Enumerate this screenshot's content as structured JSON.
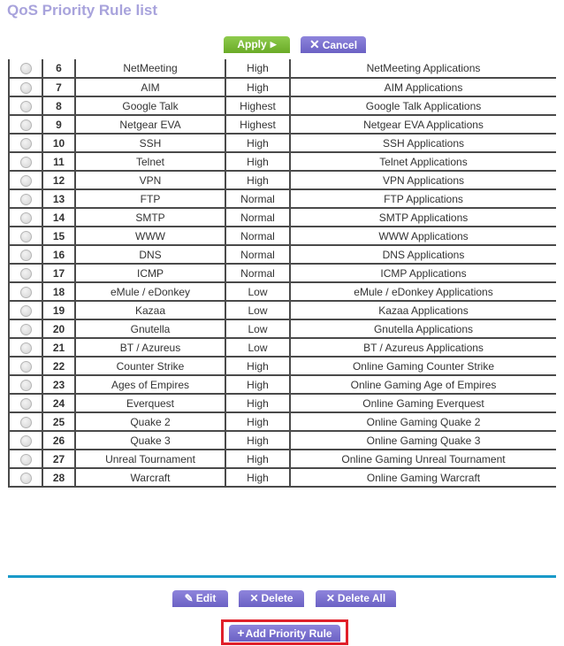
{
  "page": {
    "title": "QoS Priority Rule list"
  },
  "toolbar": {
    "apply_label": "Apply",
    "apply_icon": "play-triangle-icon",
    "cancel_label": "Cancel",
    "cancel_icon": "x-icon"
  },
  "rules": [
    {
      "num": "6",
      "name": "NetMeeting",
      "priority": "High",
      "description": "NetMeeting Applications"
    },
    {
      "num": "7",
      "name": "AIM",
      "priority": "High",
      "description": "AIM Applications"
    },
    {
      "num": "8",
      "name": "Google Talk",
      "priority": "Highest",
      "description": "Google Talk Applications"
    },
    {
      "num": "9",
      "name": "Netgear EVA",
      "priority": "Highest",
      "description": "Netgear EVA Applications"
    },
    {
      "num": "10",
      "name": "SSH",
      "priority": "High",
      "description": "SSH Applications"
    },
    {
      "num": "11",
      "name": "Telnet",
      "priority": "High",
      "description": "Telnet Applications"
    },
    {
      "num": "12",
      "name": "VPN",
      "priority": "High",
      "description": "VPN Applications"
    },
    {
      "num": "13",
      "name": "FTP",
      "priority": "Normal",
      "description": "FTP Applications"
    },
    {
      "num": "14",
      "name": "SMTP",
      "priority": "Normal",
      "description": "SMTP Applications"
    },
    {
      "num": "15",
      "name": "WWW",
      "priority": "Normal",
      "description": "WWW Applications"
    },
    {
      "num": "16",
      "name": "DNS",
      "priority": "Normal",
      "description": "DNS Applications"
    },
    {
      "num": "17",
      "name": "ICMP",
      "priority": "Normal",
      "description": "ICMP Applications"
    },
    {
      "num": "18",
      "name": "eMule / eDonkey",
      "priority": "Low",
      "description": "eMule / eDonkey Applications"
    },
    {
      "num": "19",
      "name": "Kazaa",
      "priority": "Low",
      "description": "Kazaa Applications"
    },
    {
      "num": "20",
      "name": "Gnutella",
      "priority": "Low",
      "description": "Gnutella Applications"
    },
    {
      "num": "21",
      "name": "BT / Azureus",
      "priority": "Low",
      "description": "BT / Azureus Applications"
    },
    {
      "num": "22",
      "name": "Counter Strike",
      "priority": "High",
      "description": "Online Gaming Counter Strike"
    },
    {
      "num": "23",
      "name": "Ages of Empires",
      "priority": "High",
      "description": "Online Gaming Age of Empires"
    },
    {
      "num": "24",
      "name": "Everquest",
      "priority": "High",
      "description": "Online Gaming Everquest"
    },
    {
      "num": "25",
      "name": "Quake 2",
      "priority": "High",
      "description": "Online Gaming Quake 2"
    },
    {
      "num": "26",
      "name": "Quake 3",
      "priority": "High",
      "description": "Online Gaming Quake 3"
    },
    {
      "num": "27",
      "name": "Unreal Tournament",
      "priority": "High",
      "description": "Online Gaming Unreal Tournament"
    },
    {
      "num": "28",
      "name": "Warcraft",
      "priority": "High",
      "description": "Online Gaming Warcraft"
    }
  ],
  "actions": {
    "edit_label": "Edit",
    "edit_icon": "pencil-icon",
    "delete_label": "Delete",
    "delete_icon": "x-icon",
    "delete_all_label": "Delete All",
    "delete_all_icon": "x-icon",
    "add_label": "Add Priority Rule",
    "add_icon": "plus-icon"
  },
  "colors": {
    "title": "#a8a3dc",
    "apply_button": "#7bbb38",
    "action_button": "#7a70d0",
    "rule_number": "#2a8fc6",
    "divider": "#1a9ac9",
    "highlight_box": "#e0202a"
  }
}
